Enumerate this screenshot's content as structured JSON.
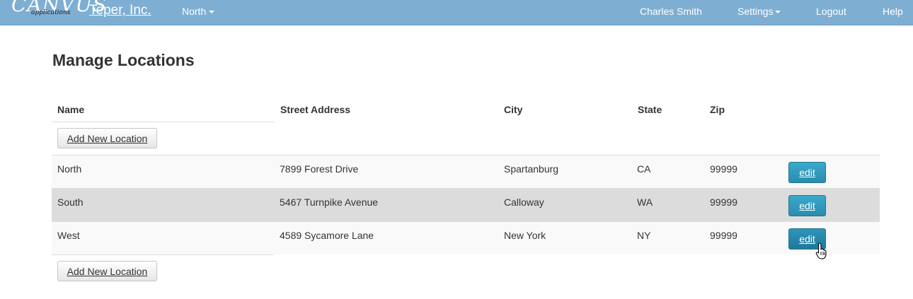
{
  "navbar": {
    "logo_main": "CANVUS",
    "logo_sub": "applications",
    "brand": "Teper, Inc.",
    "location_menu": "North",
    "user": "Charles Smith",
    "settings": "Settings",
    "logout": "Logout",
    "help": "Help"
  },
  "page": {
    "title": "Manage Locations",
    "add_button_label": "Add New Location",
    "edit_label": "edit"
  },
  "table": {
    "headers": [
      "Name",
      "Street Address",
      "City",
      "State",
      "Zip"
    ],
    "rows": [
      {
        "name": "North",
        "street": "7899 Forest Drive",
        "city": "Spartanburg",
        "state": "CA",
        "zip": "99999"
      },
      {
        "name": "South",
        "street": "5467 Turnpike Avenue",
        "city": "Calloway",
        "state": "WA",
        "zip": "99999"
      },
      {
        "name": "West",
        "street": "4589 Sycamore Lane",
        "city": "New York",
        "state": "NY",
        "zip": "99999"
      }
    ]
  },
  "colors": {
    "navbar_bg": "#7eafd3",
    "edit_button": "#2f96bd",
    "row_highlight": "#dcdcdc",
    "row_striped": "#f9f9f9"
  }
}
